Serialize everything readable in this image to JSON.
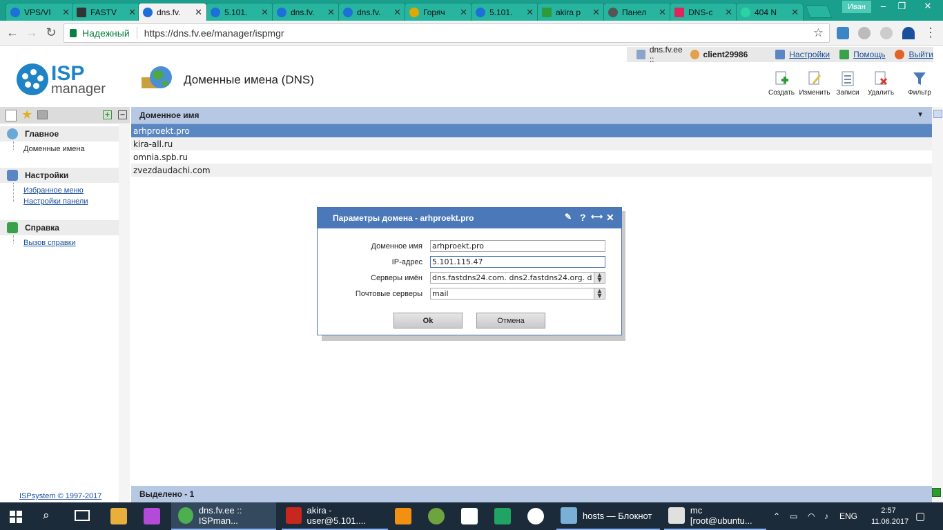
{
  "browser": {
    "tabs": [
      {
        "title": "VPS/VI",
        "active": false
      },
      {
        "title": "FASTV",
        "active": false
      },
      {
        "title": "dns.fv.",
        "active": true
      },
      {
        "title": "5.101.",
        "active": false
      },
      {
        "title": "dns.fv.",
        "active": false
      },
      {
        "title": "dns.fv.",
        "active": false
      },
      {
        "title": "Горяч",
        "active": false
      },
      {
        "title": "5.101.",
        "active": false
      },
      {
        "title": "akira р",
        "active": false
      },
      {
        "title": "Панел",
        "active": false
      },
      {
        "title": "DNS-с",
        "active": false
      },
      {
        "title": "404 N",
        "active": false
      }
    ],
    "user": "Иван",
    "secure_label": "Надежный",
    "url": "https://dns.fv.ee/manager/ispmgr"
  },
  "isp": {
    "host": "dns.fv.ee ::",
    "client": "client29986",
    "links": {
      "settings": "Настройки",
      "help": "Помощь",
      "logout": "Выйти"
    },
    "logo": {
      "isp": "ISP",
      "manager": "manager"
    },
    "page_title": "Доменные имена (DNS)",
    "toolbar": [
      "Создать",
      "Изменить",
      "Записи",
      "Удалить",
      "Фильтр"
    ]
  },
  "sidebar": {
    "sections": [
      {
        "title": "Главное",
        "items": [
          "Доменные имена"
        ]
      },
      {
        "title": "Настройки",
        "items": [
          "Избранное меню",
          "Настройки панели"
        ]
      },
      {
        "title": "Справка",
        "items": [
          "Вызов справки"
        ]
      }
    ],
    "copyright": "ISPsystem © 1997-2017"
  },
  "list": {
    "column": "Доменное имя",
    "rows": [
      "arhproekt.pro",
      "kira-all.ru",
      "omnia.spb.ru",
      "zvezdaudachi.com"
    ],
    "selected_count": "Выделено - 1"
  },
  "dialog": {
    "title": "Параметры домена - arhproekt.pro",
    "fields": [
      {
        "label": "Доменное имя",
        "value": "arhproekt.pro"
      },
      {
        "label": "IP-адрес",
        "value": "5.101.115.47"
      },
      {
        "label": "Серверы имён",
        "value": "dns.fastdns24.com. dns2.fastdns24.org. d"
      },
      {
        "label": "Почтовые серверы",
        "value": "mail"
      }
    ],
    "ok": "Ok",
    "cancel": "Отмена"
  },
  "taskbar": {
    "items": [
      "dns.fv.ee :: ISPman...",
      "akira - user@5.101....",
      "hosts — Блокнот",
      "mc [root@ubuntu..."
    ],
    "lang": "ENG",
    "time": "2:57",
    "date": "11.06.2017"
  }
}
